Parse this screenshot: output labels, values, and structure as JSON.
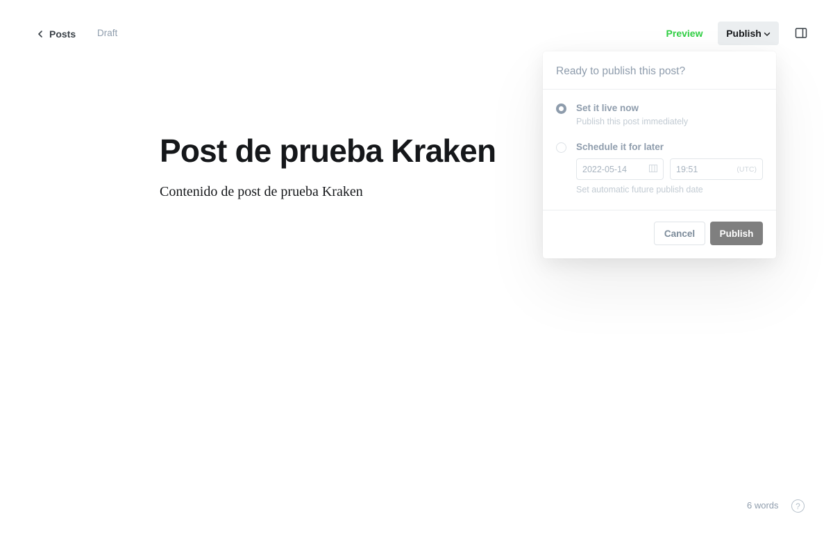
{
  "header": {
    "back_label": "Posts",
    "status": "Draft",
    "preview_label": "Preview",
    "publish_label": "Publish",
    "icons": [
      "chevron-left-icon",
      "chevron-down-icon",
      "sidebar-toggle-icon"
    ]
  },
  "editor": {
    "title": "Post de prueba Kraken",
    "body": "Contenido de post de prueba Kraken"
  },
  "footer": {
    "word_count": "6 words",
    "help_label": "?"
  },
  "publish_menu": {
    "heading": "Ready to publish this post?",
    "options": [
      {
        "title": "Set it live now",
        "subtitle": "Publish this post immediately",
        "selected": true
      },
      {
        "title": "Schedule it for later",
        "subtitle": "Set automatic future publish date",
        "selected": false
      }
    ],
    "schedule": {
      "date": "2022-05-14",
      "time": "19:51",
      "timezone": "(UTC)"
    },
    "cancel_label": "Cancel",
    "confirm_label": "Publish"
  },
  "colors": {
    "accent_green": "#30cf43",
    "text_dark": "#15171a",
    "muted": "#8e9cac",
    "publish_button_bg": "#7f7f7f"
  }
}
